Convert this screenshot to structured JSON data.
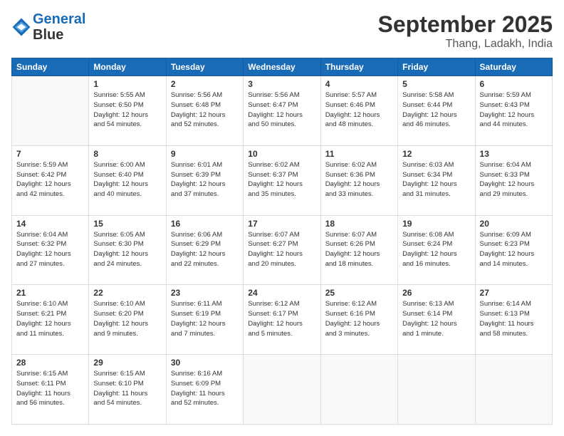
{
  "header": {
    "logo_line1": "General",
    "logo_line2": "Blue",
    "month": "September 2025",
    "location": "Thang, Ladakh, India"
  },
  "weekdays": [
    "Sunday",
    "Monday",
    "Tuesday",
    "Wednesday",
    "Thursday",
    "Friday",
    "Saturday"
  ],
  "weeks": [
    [
      {
        "day": "",
        "info": ""
      },
      {
        "day": "1",
        "info": "Sunrise: 5:55 AM\nSunset: 6:50 PM\nDaylight: 12 hours\nand 54 minutes."
      },
      {
        "day": "2",
        "info": "Sunrise: 5:56 AM\nSunset: 6:48 PM\nDaylight: 12 hours\nand 52 minutes."
      },
      {
        "day": "3",
        "info": "Sunrise: 5:56 AM\nSunset: 6:47 PM\nDaylight: 12 hours\nand 50 minutes."
      },
      {
        "day": "4",
        "info": "Sunrise: 5:57 AM\nSunset: 6:46 PM\nDaylight: 12 hours\nand 48 minutes."
      },
      {
        "day": "5",
        "info": "Sunrise: 5:58 AM\nSunset: 6:44 PM\nDaylight: 12 hours\nand 46 minutes."
      },
      {
        "day": "6",
        "info": "Sunrise: 5:59 AM\nSunset: 6:43 PM\nDaylight: 12 hours\nand 44 minutes."
      }
    ],
    [
      {
        "day": "7",
        "info": "Sunrise: 5:59 AM\nSunset: 6:42 PM\nDaylight: 12 hours\nand 42 minutes."
      },
      {
        "day": "8",
        "info": "Sunrise: 6:00 AM\nSunset: 6:40 PM\nDaylight: 12 hours\nand 40 minutes."
      },
      {
        "day": "9",
        "info": "Sunrise: 6:01 AM\nSunset: 6:39 PM\nDaylight: 12 hours\nand 37 minutes."
      },
      {
        "day": "10",
        "info": "Sunrise: 6:02 AM\nSunset: 6:37 PM\nDaylight: 12 hours\nand 35 minutes."
      },
      {
        "day": "11",
        "info": "Sunrise: 6:02 AM\nSunset: 6:36 PM\nDaylight: 12 hours\nand 33 minutes."
      },
      {
        "day": "12",
        "info": "Sunrise: 6:03 AM\nSunset: 6:34 PM\nDaylight: 12 hours\nand 31 minutes."
      },
      {
        "day": "13",
        "info": "Sunrise: 6:04 AM\nSunset: 6:33 PM\nDaylight: 12 hours\nand 29 minutes."
      }
    ],
    [
      {
        "day": "14",
        "info": "Sunrise: 6:04 AM\nSunset: 6:32 PM\nDaylight: 12 hours\nand 27 minutes."
      },
      {
        "day": "15",
        "info": "Sunrise: 6:05 AM\nSunset: 6:30 PM\nDaylight: 12 hours\nand 24 minutes."
      },
      {
        "day": "16",
        "info": "Sunrise: 6:06 AM\nSunset: 6:29 PM\nDaylight: 12 hours\nand 22 minutes."
      },
      {
        "day": "17",
        "info": "Sunrise: 6:07 AM\nSunset: 6:27 PM\nDaylight: 12 hours\nand 20 minutes."
      },
      {
        "day": "18",
        "info": "Sunrise: 6:07 AM\nSunset: 6:26 PM\nDaylight: 12 hours\nand 18 minutes."
      },
      {
        "day": "19",
        "info": "Sunrise: 6:08 AM\nSunset: 6:24 PM\nDaylight: 12 hours\nand 16 minutes."
      },
      {
        "day": "20",
        "info": "Sunrise: 6:09 AM\nSunset: 6:23 PM\nDaylight: 12 hours\nand 14 minutes."
      }
    ],
    [
      {
        "day": "21",
        "info": "Sunrise: 6:10 AM\nSunset: 6:21 PM\nDaylight: 12 hours\nand 11 minutes."
      },
      {
        "day": "22",
        "info": "Sunrise: 6:10 AM\nSunset: 6:20 PM\nDaylight: 12 hours\nand 9 minutes."
      },
      {
        "day": "23",
        "info": "Sunrise: 6:11 AM\nSunset: 6:19 PM\nDaylight: 12 hours\nand 7 minutes."
      },
      {
        "day": "24",
        "info": "Sunrise: 6:12 AM\nSunset: 6:17 PM\nDaylight: 12 hours\nand 5 minutes."
      },
      {
        "day": "25",
        "info": "Sunrise: 6:12 AM\nSunset: 6:16 PM\nDaylight: 12 hours\nand 3 minutes."
      },
      {
        "day": "26",
        "info": "Sunrise: 6:13 AM\nSunset: 6:14 PM\nDaylight: 12 hours\nand 1 minute."
      },
      {
        "day": "27",
        "info": "Sunrise: 6:14 AM\nSunset: 6:13 PM\nDaylight: 11 hours\nand 58 minutes."
      }
    ],
    [
      {
        "day": "28",
        "info": "Sunrise: 6:15 AM\nSunset: 6:11 PM\nDaylight: 11 hours\nand 56 minutes."
      },
      {
        "day": "29",
        "info": "Sunrise: 6:15 AM\nSunset: 6:10 PM\nDaylight: 11 hours\nand 54 minutes."
      },
      {
        "day": "30",
        "info": "Sunrise: 6:16 AM\nSunset: 6:09 PM\nDaylight: 11 hours\nand 52 minutes."
      },
      {
        "day": "",
        "info": ""
      },
      {
        "day": "",
        "info": ""
      },
      {
        "day": "",
        "info": ""
      },
      {
        "day": "",
        "info": ""
      }
    ]
  ]
}
